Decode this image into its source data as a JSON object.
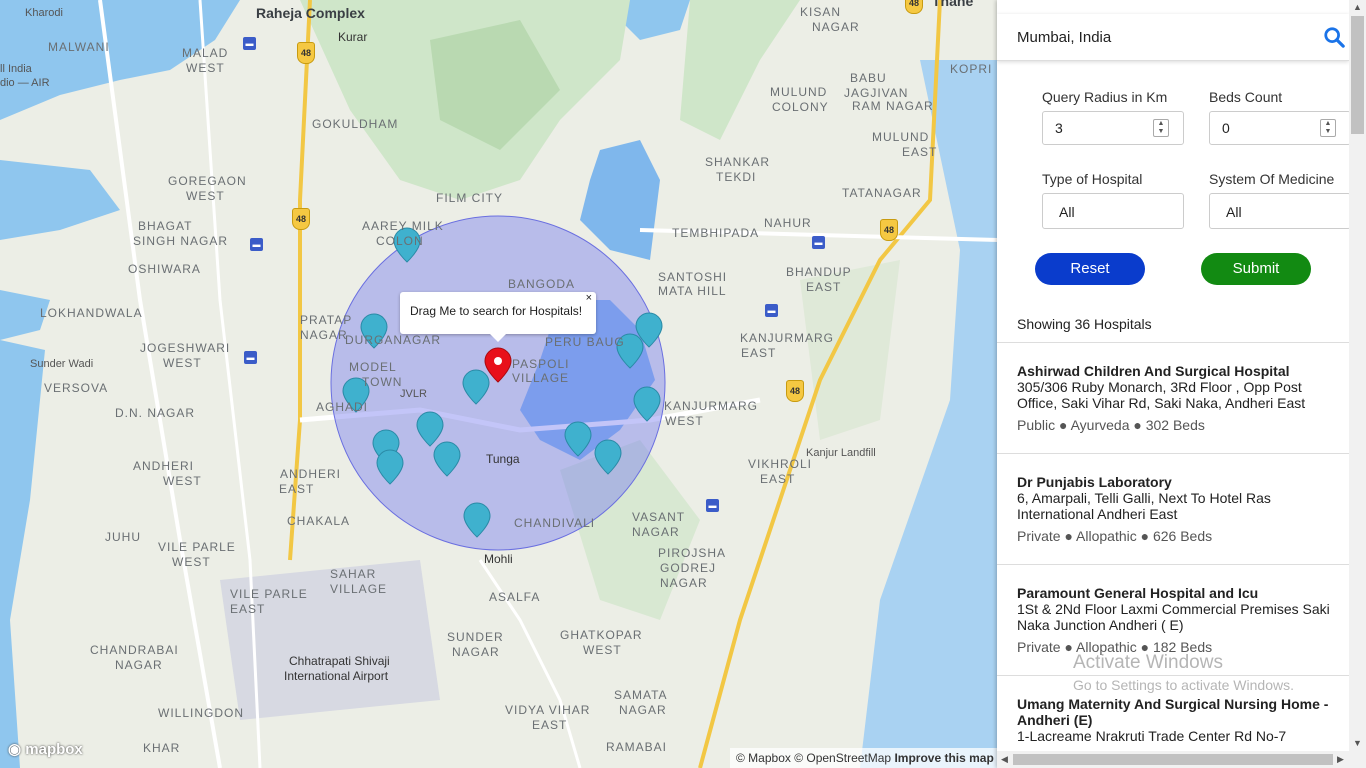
{
  "map": {
    "labels": [
      {
        "text": "Kharodi",
        "cls": "small"
      },
      {
        "text": "Raheja Complex",
        "cls": "big"
      },
      {
        "text": "Kurar",
        "cls": "dark"
      },
      {
        "text": "MALWANI",
        "cls": ""
      },
      {
        "text": "MALAD",
        "cls": ""
      },
      {
        "text": "WEST",
        "cls": ""
      },
      {
        "text": "ll India",
        "cls": "small"
      },
      {
        "text": "dio — AIR",
        "cls": "small"
      },
      {
        "text": "GOKULDHAM",
        "cls": ""
      },
      {
        "text": "GOREGAON",
        "cls": ""
      },
      {
        "text": "WEST",
        "cls": ""
      },
      {
        "text": "FILM CITY",
        "cls": ""
      },
      {
        "text": "AAREY MILK",
        "cls": ""
      },
      {
        "text": "COLON",
        "cls": ""
      },
      {
        "text": "BHAGAT",
        "cls": ""
      },
      {
        "text": "SINGH NAGAR",
        "cls": ""
      },
      {
        "text": "OSHIWARA",
        "cls": ""
      },
      {
        "text": "LOKHANDWALA",
        "cls": ""
      },
      {
        "text": "JOGESHWARI",
        "cls": ""
      },
      {
        "text": "WEST",
        "cls": ""
      },
      {
        "text": "PRATAP",
        "cls": ""
      },
      {
        "text": "NAGAR",
        "cls": ""
      },
      {
        "text": "DURGANAGAR",
        "cls": ""
      },
      {
        "text": "Sunder Wadi",
        "cls": "small"
      },
      {
        "text": "VERSOVA",
        "cls": ""
      },
      {
        "text": "MODEL",
        "cls": ""
      },
      {
        "text": "TOWN",
        "cls": ""
      },
      {
        "text": "D.N. NAGAR",
        "cls": ""
      },
      {
        "text": "AGHADI",
        "cls": ""
      },
      {
        "text": "ANDHERI",
        "cls": ""
      },
      {
        "text": "WEST",
        "cls": ""
      },
      {
        "text": "ANDHERI",
        "cls": ""
      },
      {
        "text": "EAST",
        "cls": ""
      },
      {
        "text": "JUHU",
        "cls": ""
      },
      {
        "text": "CHAKALA",
        "cls": ""
      },
      {
        "text": "VILE PARLE",
        "cls": ""
      },
      {
        "text": "WEST",
        "cls": ""
      },
      {
        "text": "SAHAR",
        "cls": ""
      },
      {
        "text": "VILLAGE",
        "cls": ""
      },
      {
        "text": "VILE PARLE",
        "cls": ""
      },
      {
        "text": "EAST",
        "cls": ""
      },
      {
        "text": "CHANDRABAI",
        "cls": ""
      },
      {
        "text": "NAGAR",
        "cls": ""
      },
      {
        "text": "WILLINGDON",
        "cls": ""
      },
      {
        "text": "KHAR",
        "cls": ""
      },
      {
        "text": "Chhatrapati Shivaji",
        "cls": "dark"
      },
      {
        "text": "International Airport",
        "cls": "dark"
      },
      {
        "text": "SUNDER",
        "cls": ""
      },
      {
        "text": "NAGAR",
        "cls": ""
      },
      {
        "text": "ASALFA",
        "cls": ""
      },
      {
        "text": "Mohli",
        "cls": "dark"
      },
      {
        "text": "CHANDIVALI",
        "cls": ""
      },
      {
        "text": "Tunga",
        "cls": "dark"
      },
      {
        "text": "BANGODA",
        "cls": ""
      },
      {
        "text": "PASPOLI",
        "cls": ""
      },
      {
        "text": "VILLAGE",
        "cls": ""
      },
      {
        "text": "PERU BAUG",
        "cls": ""
      },
      {
        "text": "KANJURMARG",
        "cls": ""
      },
      {
        "text": "WEST",
        "cls": ""
      },
      {
        "text": "KANJURMARG",
        "cls": ""
      },
      {
        "text": "EAST",
        "cls": ""
      },
      {
        "text": "SANTOSHI",
        "cls": ""
      },
      {
        "text": "MATA HILL",
        "cls": ""
      },
      {
        "text": "TEMBHIPADA",
        "cls": ""
      },
      {
        "text": "NAHUR",
        "cls": ""
      },
      {
        "text": "BHANDUP",
        "cls": ""
      },
      {
        "text": "EAST",
        "cls": ""
      },
      {
        "text": "SHANKAR",
        "cls": ""
      },
      {
        "text": "TEKDI",
        "cls": ""
      },
      {
        "text": "TATANAGAR",
        "cls": ""
      },
      {
        "text": "MULUND",
        "cls": ""
      },
      {
        "text": "EAST",
        "cls": ""
      },
      {
        "text": "KISAN",
        "cls": ""
      },
      {
        "text": "NAGAR",
        "cls": ""
      },
      {
        "text": "KOPRI",
        "cls": ""
      },
      {
        "text": "MULUND",
        "cls": ""
      },
      {
        "text": "COLONY",
        "cls": ""
      },
      {
        "text": "BABU",
        "cls": ""
      },
      {
        "text": "JAGJIVAN",
        "cls": ""
      },
      {
        "text": "RAM NAGAR",
        "cls": ""
      },
      {
        "text": "Kanjur Landfill",
        "cls": "small"
      },
      {
        "text": "VIKHROLI",
        "cls": ""
      },
      {
        "text": "EAST",
        "cls": ""
      },
      {
        "text": "VASANT",
        "cls": ""
      },
      {
        "text": "NAGAR",
        "cls": ""
      },
      {
        "text": "PIROJSHA",
        "cls": ""
      },
      {
        "text": "GODREJ",
        "cls": ""
      },
      {
        "text": "NAGAR",
        "cls": ""
      },
      {
        "text": "GHATKOPAR",
        "cls": ""
      },
      {
        "text": "WEST",
        "cls": ""
      },
      {
        "text": "SAMATA",
        "cls": ""
      },
      {
        "text": "NAGAR",
        "cls": ""
      },
      {
        "text": "VIDYA VIHAR",
        "cls": ""
      },
      {
        "text": "EAST",
        "cls": ""
      },
      {
        "text": "RAMABAI",
        "cls": ""
      },
      {
        "text": "Thane",
        "cls": "big"
      },
      {
        "text": "JVLR",
        "cls": "small"
      }
    ],
    "highways": [
      "48",
      "48",
      "48",
      "48",
      "48"
    ],
    "popup_text": "Drag Me to search for Hospitals!",
    "popup_close": "×",
    "mapbox_logo": "mapbox",
    "attribution": "© Mapbox © OpenStreetMap",
    "attribution_link": "Improve this map",
    "query_circle_color": "#7b7ff0",
    "marker_color": "#3fb1ce",
    "center_marker_color": "#e8101a"
  },
  "sidebar": {
    "search_value": "Mumbai, India",
    "radius_label": "Query Radius in Km",
    "radius_value": "3",
    "beds_label": "Beds Count",
    "beds_value": "0",
    "type_label": "Type of Hospital",
    "type_value": "All",
    "system_label": "System Of Medicine",
    "system_value": "All",
    "reset_label": "Reset",
    "submit_label": "Submit",
    "reset_color": "#0a3ccc",
    "submit_color": "#128a12",
    "count_text": "Showing 36 Hospitals",
    "hospitals": [
      {
        "name": "Ashirwad Children And Surgical Hospital",
        "address": "305/306 Ruby Monarch, 3Rd Floor , Opp Post Office, Saki Vihar Rd, Saki Naka, Andheri East",
        "meta": "Public ● Ayurveda ● 302 Beds"
      },
      {
        "name": "Dr Punjabis Laboratory",
        "address": "6, Amarpali, Telli Galli, Next To Hotel Ras International Andheri East",
        "meta": "Private ● Allopathic ● 626 Beds"
      },
      {
        "name": "Paramount General Hospital and Icu",
        "address": "1St & 2Nd Floor Laxmi Commercial Premises Saki Naka Junction Andheri ( E)",
        "meta": "Private ● Allopathic ● 182 Beds"
      },
      {
        "name": "Umang Maternity And Surgical Nursing Home -Andheri (E)",
        "address": "1-Lacreame Nrakruti Trade Center Rd No-7",
        "meta": ""
      }
    ]
  },
  "watermark": {
    "line1": "Activate Windows",
    "line2": "Go to Settings to activate Windows."
  }
}
